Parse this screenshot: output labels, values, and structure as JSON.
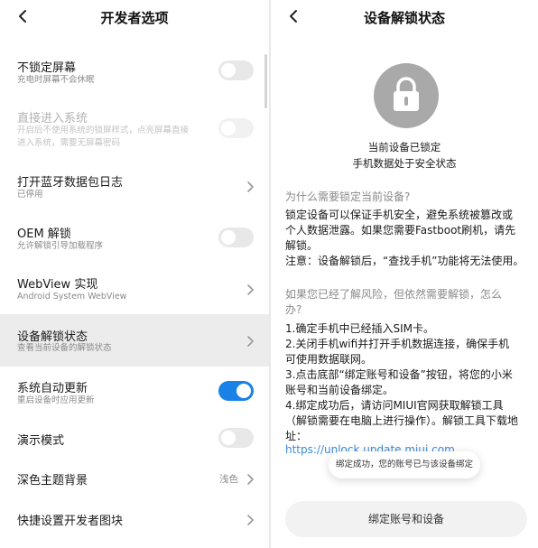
{
  "left": {
    "title": "开发者选项",
    "items": [
      {
        "title": "不锁定屏幕",
        "subtitle": "充电时屏幕不会休眠",
        "control": "toggle",
        "on": false
      },
      {
        "title": "直接进入系统",
        "subtitle_lines": [
          "开启后不使用系统的锁屏样式，点亮屏幕直接",
          "进入系统，需要无屏幕密码"
        ],
        "control": "toggle",
        "disabled": true,
        "on": false
      },
      {
        "title": "打开蓝牙数据包日志",
        "subtitle": "已停用",
        "control": "chevron"
      },
      {
        "title": "OEM 解锁",
        "subtitle": "允许解锁引导加载程序",
        "control": "toggle",
        "on": false
      },
      {
        "title": "WebView 实现",
        "subtitle": "Android System WebView",
        "control": "chevron"
      },
      {
        "title": "设备解锁状态",
        "subtitle": "查看当前设备的解锁状态",
        "control": "chevron",
        "active": true
      },
      {
        "title": "系统自动更新",
        "subtitle": "重启设备时应用更新",
        "control": "toggle",
        "on": true
      },
      {
        "title": "演示模式",
        "control": "toggle",
        "on": false
      },
      {
        "title": "深色主题背景",
        "value": "浅色",
        "control": "chevron"
      },
      {
        "title": "快捷设置开发者图块",
        "control": "chevron"
      }
    ]
  },
  "right": {
    "title": "设备解锁状态",
    "status_line1": "当前设备已锁定",
    "status_line2": "手机数据处于安全状态",
    "question1": "为什么需要锁定当前设备?",
    "para1": [
      "锁定设备可以保证手机安全，避免系统被篡改或",
      "个人数据泄露。如果您需要Fastboot刷机，请先",
      "解锁。",
      "注意：设备解锁后，“查找手机”功能将无法使用。"
    ],
    "question2_lines": [
      "如果您已经了解风险，但依然需要解锁，怎么",
      "办?"
    ],
    "steps": [
      "1.确定手机中已经插入SIM卡。",
      "2.关闭手机wifi并打开手机数据连接，确保手机",
      "可使用数据联网。",
      "3.点击底部“绑定账号和设备”按钮，将您的小米",
      "账号和当前设备绑定。",
      "4.绑定成功后，请访问MIUI官网获取解锁工具",
      "（解锁需要在电脑上进行操作）。解锁工具下载地",
      "址："
    ],
    "link": "https://unlock.update.miui.com",
    "toast": "绑定成功，您的账号已与该设备绑定",
    "bind_button": "绑定账号和设备"
  },
  "colors": {
    "accent": "#1a82e6",
    "link": "#3c8ad9"
  }
}
